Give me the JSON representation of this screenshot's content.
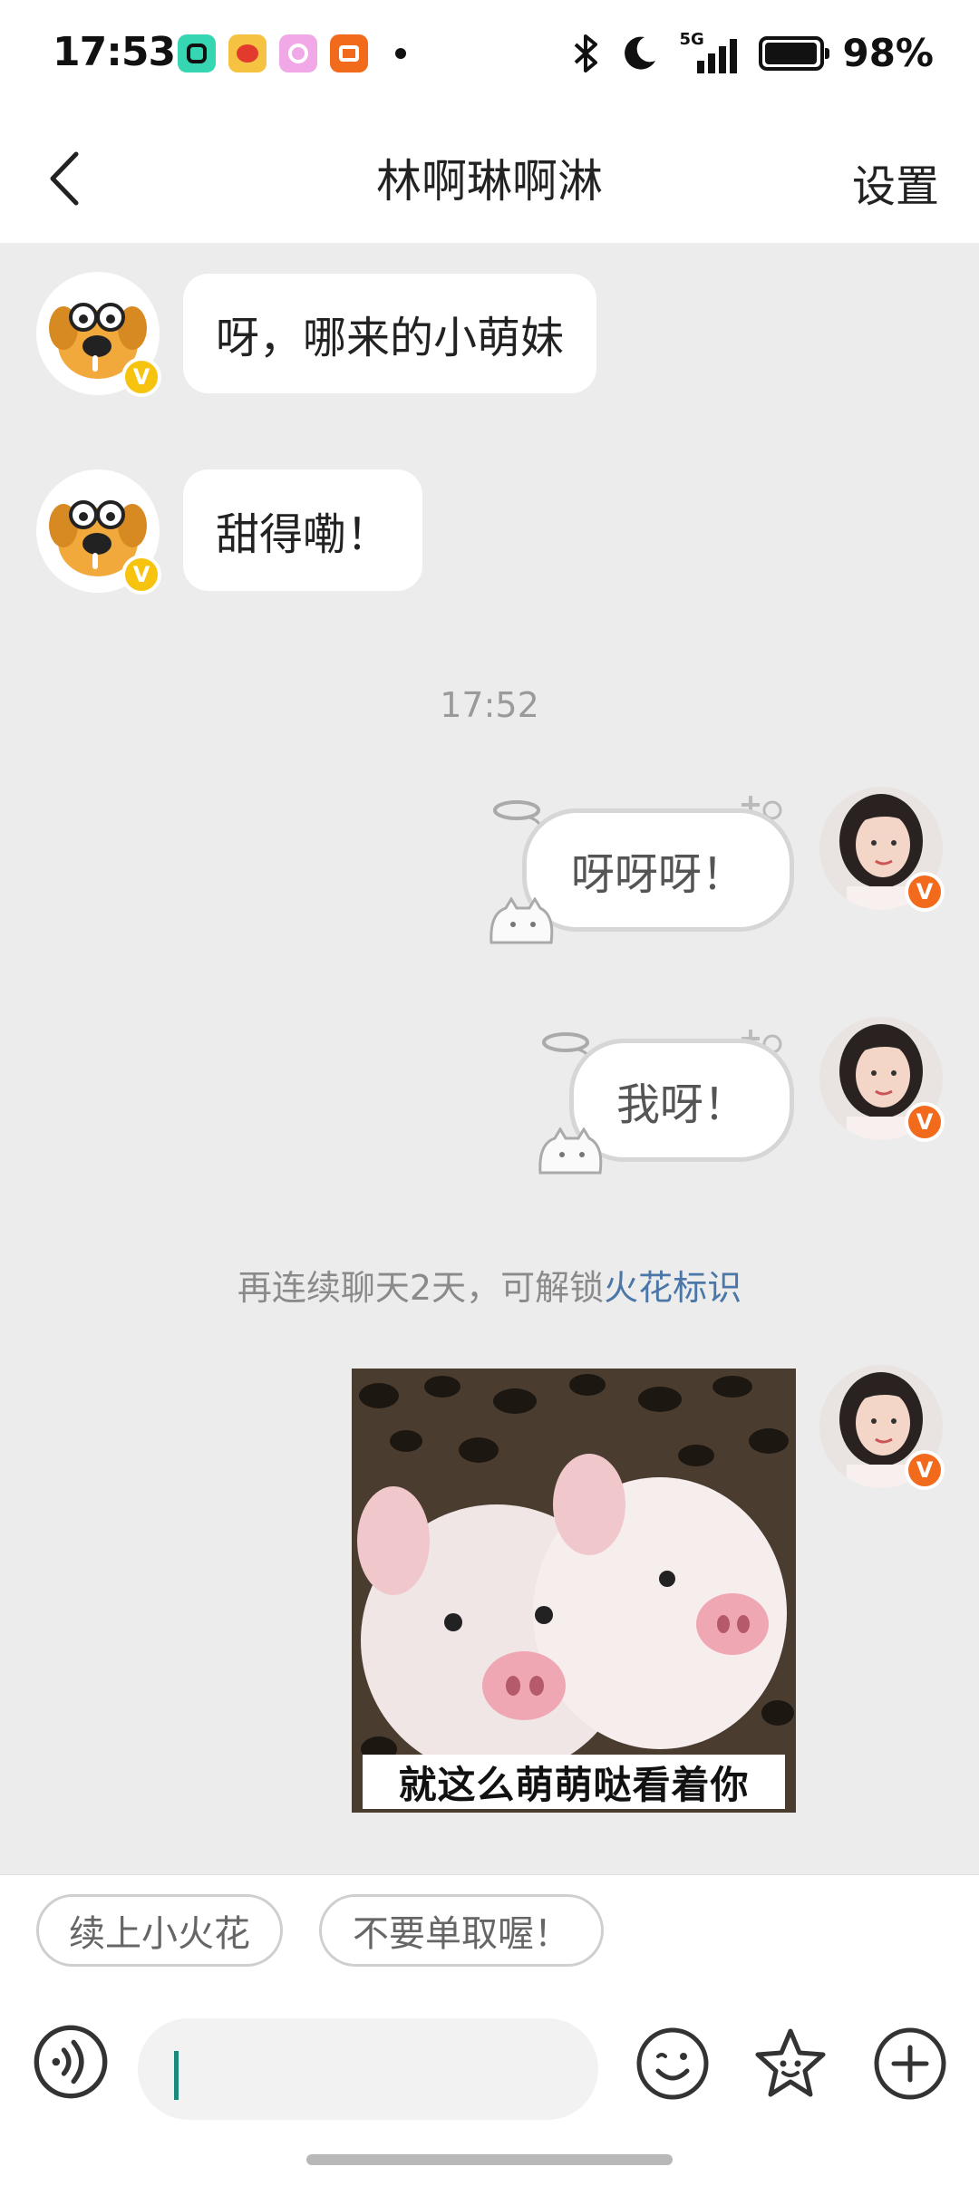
{
  "status_bar": {
    "time": "17:53",
    "battery_percent": "98%",
    "battery_level": 0.98,
    "network": "5G",
    "icons": [
      "bluetooth-icon",
      "moon-icon",
      "signal-icon",
      "battery-icon"
    ]
  },
  "header": {
    "back_icon": "chevron-left-icon",
    "title": "林啊琳啊淋",
    "settings_label": "设置"
  },
  "messages": [
    {
      "side": "left",
      "text": "呀，哪来的小萌妹"
    },
    {
      "side": "left",
      "text": "甜得嘞！"
    },
    {
      "timestamp": "17:52"
    },
    {
      "side": "right",
      "text": "呀呀呀！"
    },
    {
      "side": "right",
      "text": "我呀！"
    },
    {
      "system": "再连续聊天2天，可解锁",
      "system_link": "火花标识"
    },
    {
      "side": "right",
      "type": "sticker",
      "caption": "就这么萌萌哒看着你"
    }
  ],
  "avatar_badge": "V",
  "quick_replies": [
    "续上小火花",
    "不要单取喔！"
  ],
  "input_bar": {
    "icons": [
      "voice-icon",
      "emoji-icon",
      "sticker-star-icon",
      "plus-icon"
    ]
  }
}
